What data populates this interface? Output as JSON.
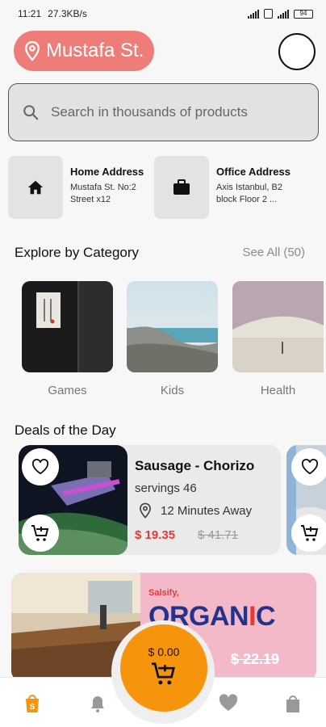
{
  "status_bar": {
    "time": "11:21",
    "net_speed": "27.3KB/s",
    "battery": "94"
  },
  "header": {
    "location": "Mustafa St."
  },
  "search": {
    "placeholder": "Search in thousands of products"
  },
  "addresses": [
    {
      "title": "Home Address",
      "line1": "Mustafa St. No:2",
      "line2": "Street x12",
      "icon": "home-icon"
    },
    {
      "title": "Office Address",
      "line1": "Axis Istanbul, B2",
      "line2": "block Floor 2 ...",
      "icon": "briefcase-icon"
    }
  ],
  "categories_section": {
    "title": "Explore by Category",
    "see_all": "See All (50)"
  },
  "categories": [
    {
      "label": "Games"
    },
    {
      "label": "Kids"
    },
    {
      "label": "Health"
    }
  ],
  "deals_section": {
    "title": "Deals of the Day"
  },
  "deal": {
    "name": "Sausage - Chorizo",
    "servings": "servings 46",
    "distance": "12 Minutes Away",
    "price": "$ 19.35",
    "old_price": "$ 41.71"
  },
  "banner": {
    "brand": "Salsify,",
    "headline_part1": "ORGAN",
    "headline_accent": "I",
    "headline_part2": "C",
    "old_price": "$ 22.19"
  },
  "cart": {
    "total": "$ 0.00"
  },
  "colors": {
    "accent": "#ee7d79",
    "cart": "#f7940d",
    "price_red": "#e53935"
  }
}
